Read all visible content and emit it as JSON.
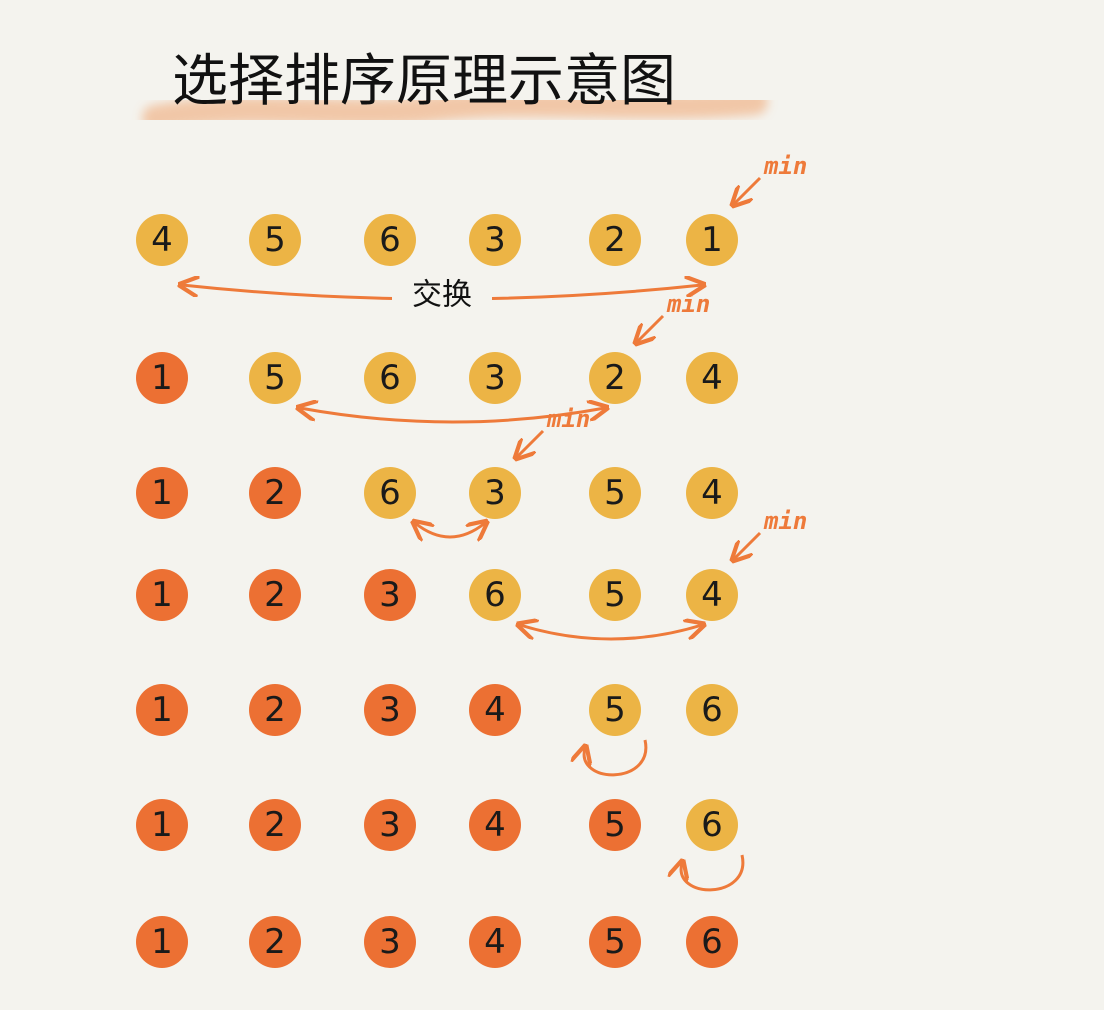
{
  "title": "选择排序原理示意图",
  "swap_label": "交换",
  "min_label": "min",
  "colors": {
    "unsorted": "#ecb445",
    "sorted": "#ec7033",
    "arrow": "#ee7a3a",
    "highlight": "#f1c09b",
    "background": "#f4f3ee"
  },
  "rows": [
    {
      "values": [
        4,
        5,
        6,
        3,
        2,
        1
      ],
      "sorted_count": 0,
      "min_index": 5,
      "swap": [
        0,
        5
      ],
      "swap_labeled": true
    },
    {
      "values": [
        1,
        5,
        6,
        3,
        2,
        4
      ],
      "sorted_count": 1,
      "min_index": 4,
      "swap": [
        1,
        4
      ]
    },
    {
      "values": [
        1,
        2,
        6,
        3,
        5,
        4
      ],
      "sorted_count": 2,
      "min_index": 3,
      "swap": [
        2,
        3
      ]
    },
    {
      "values": [
        1,
        2,
        3,
        6,
        5,
        4
      ],
      "sorted_count": 3,
      "min_index": 5,
      "swap": [
        3,
        5
      ]
    },
    {
      "values": [
        1,
        2,
        3,
        4,
        5,
        6
      ],
      "sorted_count": 4,
      "swap": [
        4,
        4
      ]
    },
    {
      "values": [
        1,
        2,
        3,
        4,
        5,
        6
      ],
      "sorted_count": 5,
      "swap": [
        5,
        5
      ]
    },
    {
      "values": [
        1,
        2,
        3,
        4,
        5,
        6
      ],
      "sorted_count": 6
    }
  ]
}
